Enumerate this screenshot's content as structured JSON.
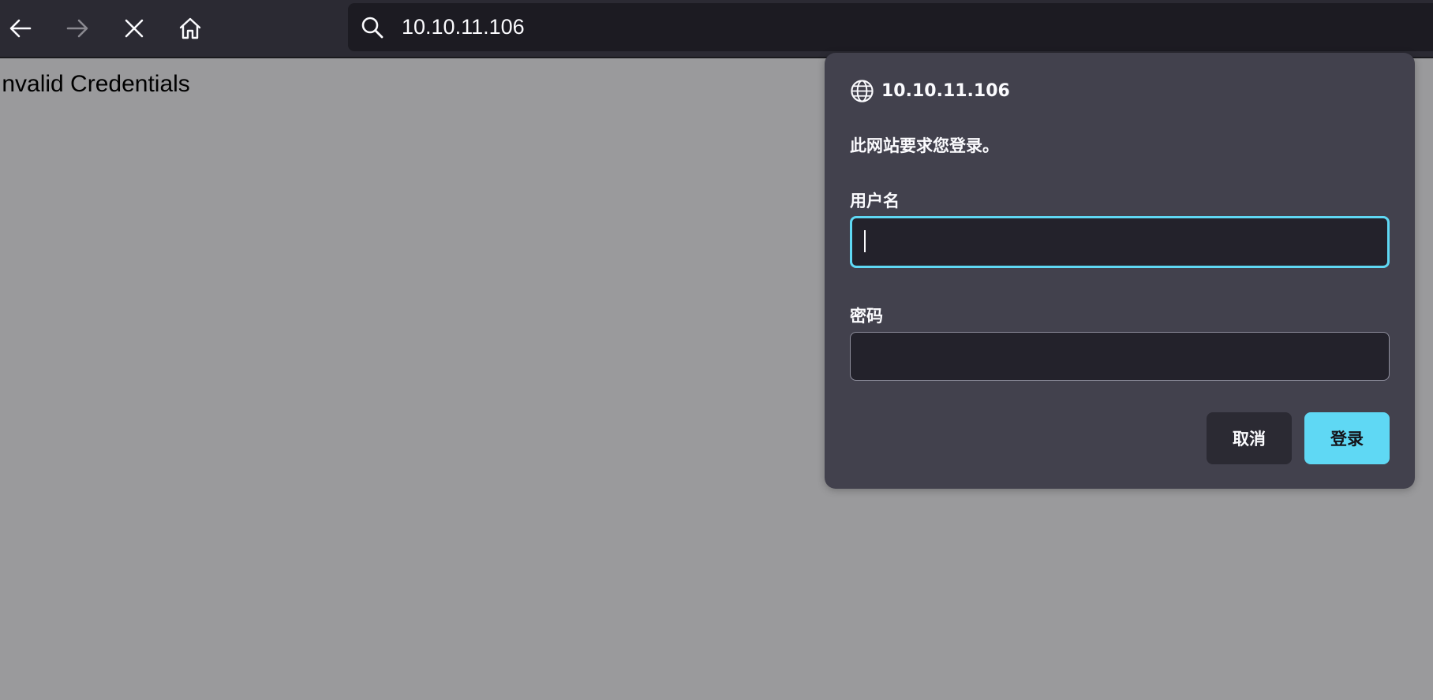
{
  "toolbar": {
    "back_icon": "arrow-left-icon",
    "forward_icon": "arrow-right-icon",
    "forward_enabled": false,
    "stop_icon": "close-icon",
    "home_icon": "home-icon",
    "search_icon": "search-icon",
    "url": "10.10.11.106"
  },
  "page": {
    "message": "Invalid Credentials"
  },
  "auth_dialog": {
    "host_icon": "globe-icon",
    "host": "10.10.11.106",
    "message": "此网站要求您登录。",
    "username_label": "用户名",
    "username_value": "",
    "password_label": "密码",
    "password_value": "",
    "cancel_label": "取消",
    "login_label": "登录"
  },
  "colors": {
    "toolbar_bg": "#2b2a33",
    "urlbar_bg": "#1c1b22",
    "page_bg": "#9a9a9c",
    "dialog_bg": "#42414d",
    "accent": "#5fd8f4",
    "input_bg": "#23222b"
  }
}
